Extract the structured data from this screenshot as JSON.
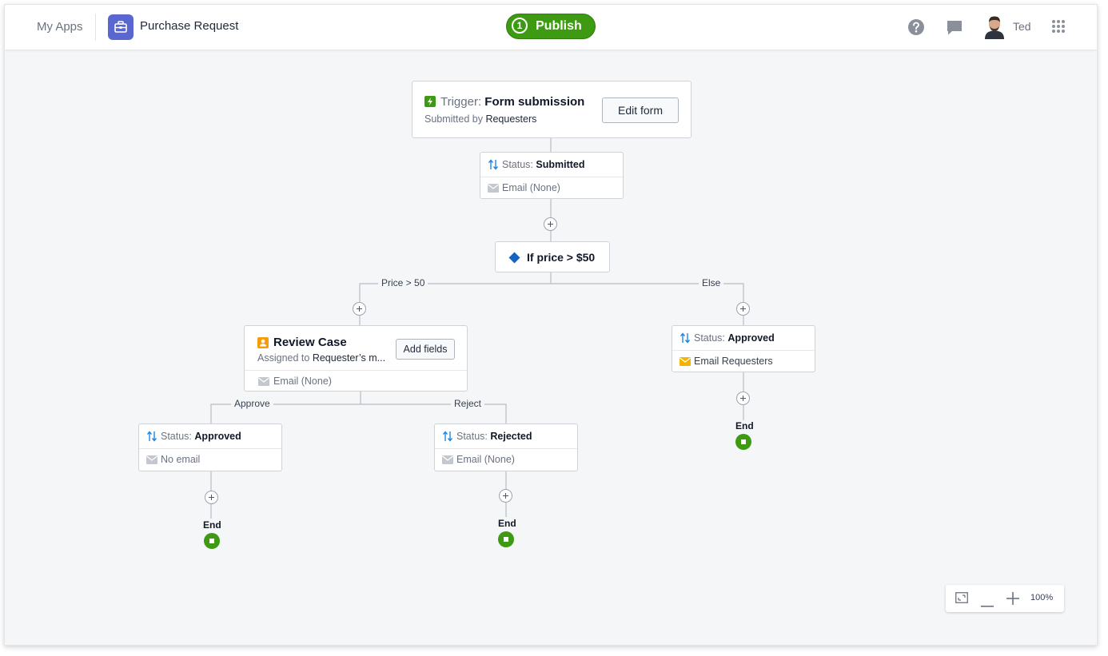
{
  "header": {
    "my_apps": "My Apps",
    "app_title": "Purchase Request",
    "app_icon": "toolbox-icon",
    "publish": {
      "count": "1",
      "label": "Publish",
      "color": "#3d9a12"
    },
    "user_name": "Ted"
  },
  "workflow": {
    "trigger": {
      "prefix": "Trigger:",
      "name": "Form submission",
      "submitted_by_prefix": "Submitted by",
      "submitted_by": "Requesters",
      "edit_button": "Edit form"
    },
    "status_submitted": {
      "prefix": "Status:",
      "value": "Submitted",
      "email": "Email (None)"
    },
    "condition": {
      "label": "If price > $50",
      "color": "#1565c0"
    },
    "branches": {
      "left": "Price > 50",
      "right": "Else"
    },
    "review_case": {
      "title": "Review Case",
      "assigned_prefix": "Assigned to",
      "assigned_to": "Requester’s m...",
      "add_fields_button": "Add fields",
      "email": "Email (None)"
    },
    "review_branches": {
      "approve": "Approve",
      "reject": "Reject"
    },
    "status_approved_left": {
      "prefix": "Status:",
      "value": "Approved",
      "email": "No email"
    },
    "status_rejected": {
      "prefix": "Status:",
      "value": "Rejected",
      "email": "Email (None)"
    },
    "status_approved_right": {
      "prefix": "Status:",
      "value": "Approved",
      "email": "Email Requesters"
    },
    "end_label": "End"
  },
  "zoom": {
    "level": "100%"
  },
  "colors": {
    "accent": "#3d9a12",
    "app_icon_bg": "#5b67d1",
    "task_icon": "#f59e0b",
    "email_active": "#f5b400"
  }
}
